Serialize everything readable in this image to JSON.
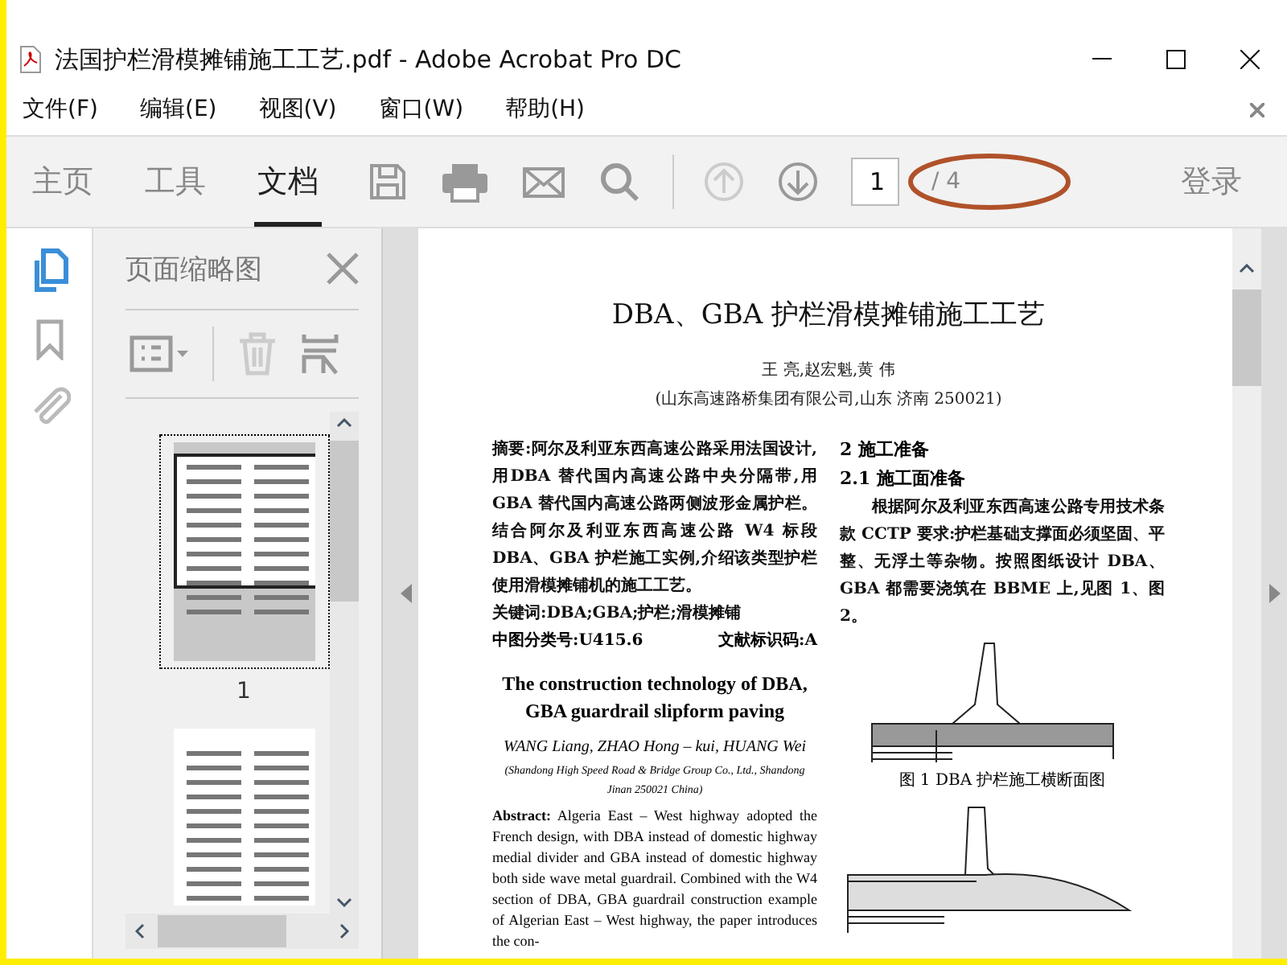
{
  "window": {
    "title": "法国护栏滑模摊铺施工工艺.pdf - Adobe Acrobat Pro DC"
  },
  "menu": [
    "文件(F)",
    "编辑(E)",
    "视图(V)",
    "窗口(W)",
    "帮助(H)"
  ],
  "tabs": [
    {
      "label": "主页",
      "selected": false
    },
    {
      "label": "工具",
      "selected": false
    },
    {
      "label": "文档",
      "selected": true
    }
  ],
  "page_nav": {
    "value": "1",
    "total": "/ 4",
    "annotated": true
  },
  "login": "登录",
  "side_panel": {
    "title": "页面缩略图",
    "thumbnails": [
      {
        "label": "1",
        "selected": true
      },
      {
        "selected": false
      }
    ]
  },
  "document": {
    "title": "DBA、GBA 护栏滑模摊铺施工工艺",
    "authors": "王  亮,赵宏魁,黄  伟",
    "affiliation": "(山东高速路桥集团有限公司,山东 济南  250021)",
    "abstract": "**摘要:**阿尔及利亚东西高速公路采用法国设计,用DBA 替代国内高速公路中央分隔带,用 GBA 替代国内高速公路两侧波形金属护栏。结合阿尔及利亚东西高速公路 W4 标段 DBA、GBA 护栏施工实例,介绍该类型护栏使用滑模摊铺机的施工工艺。",
    "keywords": "**关键词:**DBA;GBA;护栏;滑模摊铺",
    "classification": "中图分类号:U415.6",
    "doc_code": "文献标识码:A",
    "en_title": "The construction technology of DBA, GBA guardrail slipform paving",
    "en_authors": "WANG Liang, ZHAO Hong – kui, HUANG Wei",
    "en_affiliation": "(Shandong High Speed Road & Bridge Group Co., Ltd., Shandong Jinan 250021 China)",
    "en_abstract": "**Abstract:** Algeria East – West highway adopted the French design, with DBA instead of domestic highway medial divider and GBA instead of domestic highway both side wave metal guardrail. Combined with the W4 section of DBA, GBA guardrail construction example of Algerian East – West highway, the paper introduces the con-",
    "section": "2   施工准备",
    "subsection": "2.1   施工面准备",
    "body": "根据阿尔及利亚东西高速公路专用技术条款 CCTP 要求:护栏基础支撑面必须坚固、平整、无浮土等杂物。按照图纸设计 DBA、GBA 都需要浇筑在 BBME 上,见图 1、图 2。",
    "figure_caption": "图 1   DBA 护栏施工横断面图"
  }
}
